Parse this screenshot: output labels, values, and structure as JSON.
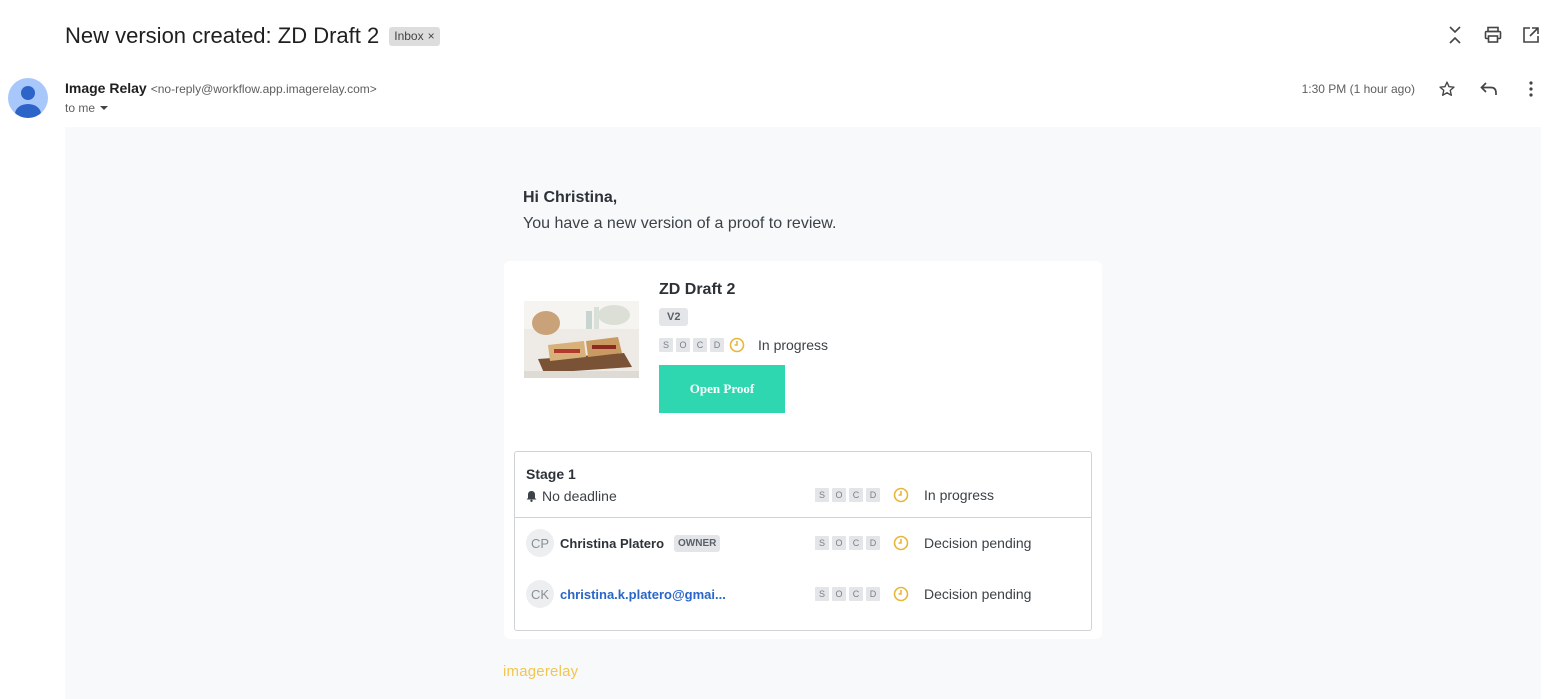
{
  "header": {
    "subject": "New version created: ZD Draft 2",
    "label": "Inbox",
    "label_remove": "×"
  },
  "top_icons": [
    "collapse-icon",
    "print-icon",
    "open-in-new-window-icon"
  ],
  "sender": {
    "name": "Image Relay",
    "email": "<no-reply@workflow.app.imagerelay.com>",
    "to": "to me",
    "timestamp": "1:30 PM (1 hour ago)"
  },
  "message": {
    "greeting": "Hi Christina,",
    "intro": "You have a new version of a proof to review."
  },
  "proof": {
    "title": "ZD Draft 2",
    "version": "V2",
    "socd": [
      "S",
      "O",
      "C",
      "D"
    ],
    "status": "In progress",
    "open_button": "Open Proof"
  },
  "stage": {
    "title": "Stage 1",
    "deadline": "No deadline",
    "status": "In progress",
    "reviewers": [
      {
        "initials": "CP",
        "name": "Christina Platero",
        "badge": "OWNER",
        "status": "Decision pending"
      },
      {
        "initials": "CK",
        "name": "christina.k.platero@gmai...",
        "status": "Decision pending"
      }
    ]
  },
  "footer": {
    "brand": "imagerelay"
  },
  "colors": {
    "accent": "#2fd7b0",
    "clock": "#e8b73a",
    "link": "#2966c8",
    "logo": "#f0c64e"
  }
}
